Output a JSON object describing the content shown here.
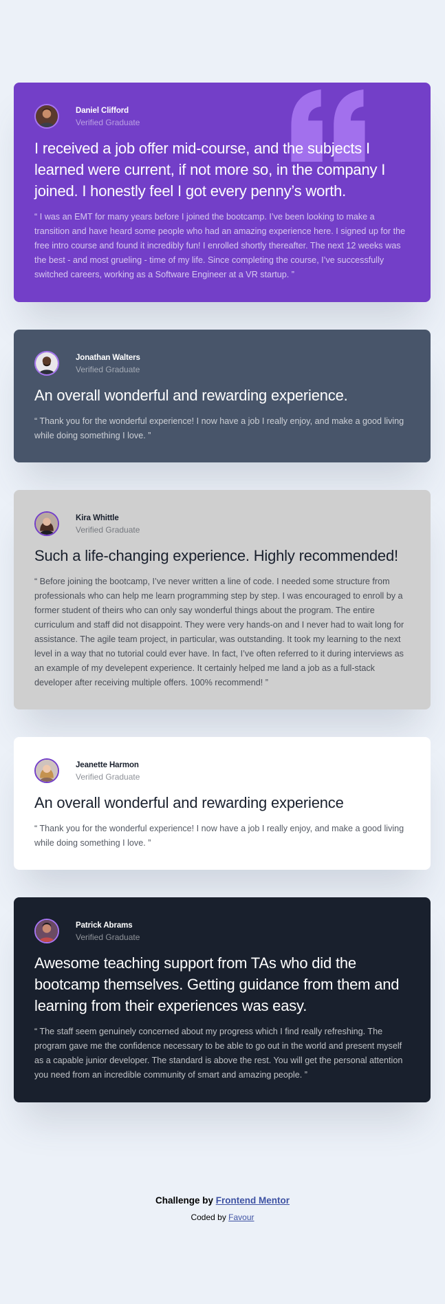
{
  "colors": {
    "page_background": "#ecf1f8",
    "moderate_violet": "#733fc8",
    "grayish_blue": "#48556a",
    "light_gray": "#cfcfcf",
    "white": "#ffffff",
    "very_dark_blackish_blue": "#19202d",
    "light_violet_accent": "#a775f1",
    "link_blue": "#3e52a3"
  },
  "testimonials": [
    {
      "name": "Daniel Clifford",
      "role": "Verified Graduate",
      "avatar_icon": "person-avatar-icon",
      "headline": "I received a job offer mid-course, and the subjects I learned were current, if not more so, in the company I joined. I honestly feel I got every penny’s worth.",
      "quote": "“ I was an EMT for many years before I joined the bootcamp. I’ve been looking to make a transition and have heard some people who had an amazing experience here. I signed up for the free intro course and found it incredibly fun! I enrolled shortly thereafter. The next 12 weeks was the best - and most grueling - time of my life. Since completing the course, I’ve successfully switched careers, working as a Software Engineer at a VR startup. ”"
    },
    {
      "name": "Jonathan Walters",
      "role": "Verified Graduate",
      "avatar_icon": "person-avatar-icon",
      "headline": "An overall wonderful and rewarding experience.",
      "quote": "“ Thank you for the wonderful experience! I now have a job I really enjoy, and make a good living while doing something I love. ”"
    },
    {
      "name": "Kira Whittle",
      "role": "Verified Graduate",
      "avatar_icon": "person-avatar-icon",
      "headline": "Such a life-changing experience. Highly recommended!",
      "quote": "“ Before joining the bootcamp, I’ve never written a line of code. I needed some structure from professionals who can help me learn programming step by step. I was encouraged to enroll by a former student of theirs who can only say wonderful things about the program. The entire curriculum and staff did not disappoint. They were very hands-on and I never had to wait long for assistance. The agile team project, in particular, was outstanding. It took my learning to the next level in a way that no tutorial could ever have. In fact, I’ve often referred to it during interviews as an example of my develepent experience. It certainly helped me land a job as a full-stack developer after receiving multiple offers. 100% recommend! ”"
    },
    {
      "name": "Jeanette Harmon",
      "role": "Verified Graduate",
      "avatar_icon": "person-avatar-icon",
      "headline": "An overall wonderful and rewarding experience",
      "quote": "“ Thank you for the wonderful experience! I now have a job I really enjoy, and make a good living while doing something I love. ”"
    },
    {
      "name": "Patrick Abrams",
      "role": "Verified Graduate",
      "avatar_icon": "person-avatar-icon",
      "headline": "Awesome teaching support from TAs who did the bootcamp themselves. Getting guidance from them and learning from their experiences was easy.",
      "quote": "“ The staff seem genuinely concerned about my progress which I find really refreshing. The program gave me the confidence necessary to be able to go out in the world and present myself as a capable junior developer. The standard is above the rest. You will get the personal attention you need from an incredible community of smart and amazing people. ”"
    }
  ],
  "decorations": {
    "quote_mark_icon": "quotation-mark-icon"
  },
  "attribution": {
    "challenge_prefix": "Challenge by",
    "challenge_link": "Frontend Mentor",
    "coded_prefix": "Coded by",
    "coded_link": "Favour"
  }
}
